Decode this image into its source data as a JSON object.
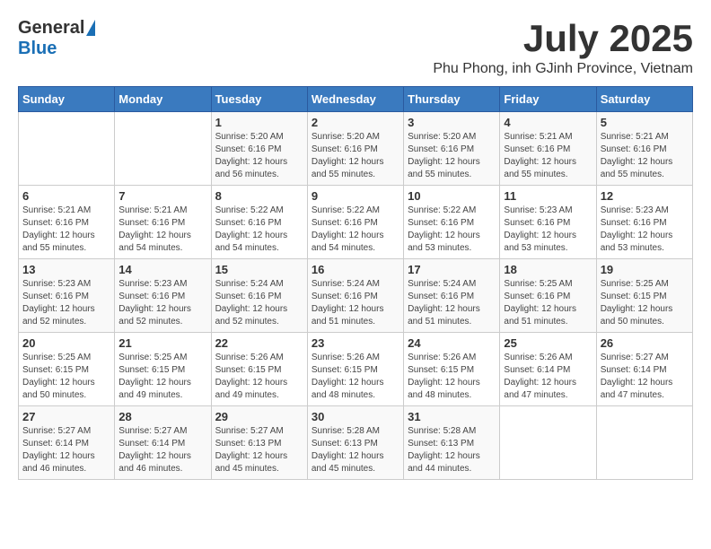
{
  "header": {
    "logo_general": "General",
    "logo_blue": "Blue",
    "month_title": "July 2025",
    "location": "Phu Phong, inh GJinh Province, Vietnam"
  },
  "days_of_week": [
    "Sunday",
    "Monday",
    "Tuesday",
    "Wednesday",
    "Thursday",
    "Friday",
    "Saturday"
  ],
  "weeks": [
    [
      {
        "day": "",
        "info": ""
      },
      {
        "day": "",
        "info": ""
      },
      {
        "day": "1",
        "info": "Sunrise: 5:20 AM\nSunset: 6:16 PM\nDaylight: 12 hours and 56 minutes."
      },
      {
        "day": "2",
        "info": "Sunrise: 5:20 AM\nSunset: 6:16 PM\nDaylight: 12 hours and 55 minutes."
      },
      {
        "day": "3",
        "info": "Sunrise: 5:20 AM\nSunset: 6:16 PM\nDaylight: 12 hours and 55 minutes."
      },
      {
        "day": "4",
        "info": "Sunrise: 5:21 AM\nSunset: 6:16 PM\nDaylight: 12 hours and 55 minutes."
      },
      {
        "day": "5",
        "info": "Sunrise: 5:21 AM\nSunset: 6:16 PM\nDaylight: 12 hours and 55 minutes."
      }
    ],
    [
      {
        "day": "6",
        "info": "Sunrise: 5:21 AM\nSunset: 6:16 PM\nDaylight: 12 hours and 55 minutes."
      },
      {
        "day": "7",
        "info": "Sunrise: 5:21 AM\nSunset: 6:16 PM\nDaylight: 12 hours and 54 minutes."
      },
      {
        "day": "8",
        "info": "Sunrise: 5:22 AM\nSunset: 6:16 PM\nDaylight: 12 hours and 54 minutes."
      },
      {
        "day": "9",
        "info": "Sunrise: 5:22 AM\nSunset: 6:16 PM\nDaylight: 12 hours and 54 minutes."
      },
      {
        "day": "10",
        "info": "Sunrise: 5:22 AM\nSunset: 6:16 PM\nDaylight: 12 hours and 53 minutes."
      },
      {
        "day": "11",
        "info": "Sunrise: 5:23 AM\nSunset: 6:16 PM\nDaylight: 12 hours and 53 minutes."
      },
      {
        "day": "12",
        "info": "Sunrise: 5:23 AM\nSunset: 6:16 PM\nDaylight: 12 hours and 53 minutes."
      }
    ],
    [
      {
        "day": "13",
        "info": "Sunrise: 5:23 AM\nSunset: 6:16 PM\nDaylight: 12 hours and 52 minutes."
      },
      {
        "day": "14",
        "info": "Sunrise: 5:23 AM\nSunset: 6:16 PM\nDaylight: 12 hours and 52 minutes."
      },
      {
        "day": "15",
        "info": "Sunrise: 5:24 AM\nSunset: 6:16 PM\nDaylight: 12 hours and 52 minutes."
      },
      {
        "day": "16",
        "info": "Sunrise: 5:24 AM\nSunset: 6:16 PM\nDaylight: 12 hours and 51 minutes."
      },
      {
        "day": "17",
        "info": "Sunrise: 5:24 AM\nSunset: 6:16 PM\nDaylight: 12 hours and 51 minutes."
      },
      {
        "day": "18",
        "info": "Sunrise: 5:25 AM\nSunset: 6:16 PM\nDaylight: 12 hours and 51 minutes."
      },
      {
        "day": "19",
        "info": "Sunrise: 5:25 AM\nSunset: 6:15 PM\nDaylight: 12 hours and 50 minutes."
      }
    ],
    [
      {
        "day": "20",
        "info": "Sunrise: 5:25 AM\nSunset: 6:15 PM\nDaylight: 12 hours and 50 minutes."
      },
      {
        "day": "21",
        "info": "Sunrise: 5:25 AM\nSunset: 6:15 PM\nDaylight: 12 hours and 49 minutes."
      },
      {
        "day": "22",
        "info": "Sunrise: 5:26 AM\nSunset: 6:15 PM\nDaylight: 12 hours and 49 minutes."
      },
      {
        "day": "23",
        "info": "Sunrise: 5:26 AM\nSunset: 6:15 PM\nDaylight: 12 hours and 48 minutes."
      },
      {
        "day": "24",
        "info": "Sunrise: 5:26 AM\nSunset: 6:15 PM\nDaylight: 12 hours and 48 minutes."
      },
      {
        "day": "25",
        "info": "Sunrise: 5:26 AM\nSunset: 6:14 PM\nDaylight: 12 hours and 47 minutes."
      },
      {
        "day": "26",
        "info": "Sunrise: 5:27 AM\nSunset: 6:14 PM\nDaylight: 12 hours and 47 minutes."
      }
    ],
    [
      {
        "day": "27",
        "info": "Sunrise: 5:27 AM\nSunset: 6:14 PM\nDaylight: 12 hours and 46 minutes."
      },
      {
        "day": "28",
        "info": "Sunrise: 5:27 AM\nSunset: 6:14 PM\nDaylight: 12 hours and 46 minutes."
      },
      {
        "day": "29",
        "info": "Sunrise: 5:27 AM\nSunset: 6:13 PM\nDaylight: 12 hours and 45 minutes."
      },
      {
        "day": "30",
        "info": "Sunrise: 5:28 AM\nSunset: 6:13 PM\nDaylight: 12 hours and 45 minutes."
      },
      {
        "day": "31",
        "info": "Sunrise: 5:28 AM\nSunset: 6:13 PM\nDaylight: 12 hours and 44 minutes."
      },
      {
        "day": "",
        "info": ""
      },
      {
        "day": "",
        "info": ""
      }
    ]
  ]
}
